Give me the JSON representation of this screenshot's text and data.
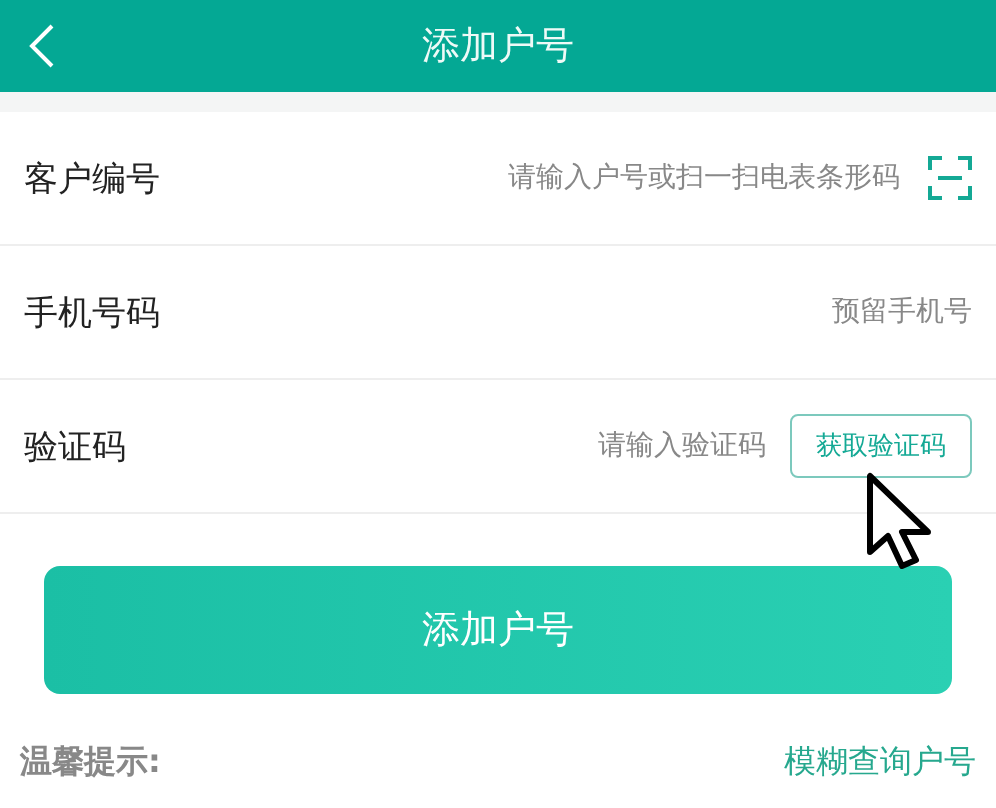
{
  "header": {
    "title": "添加户号"
  },
  "fields": [
    {
      "label": "客户编号",
      "placeholder": "请输入户号或扫一扫电表条形码",
      "kind": "scan"
    },
    {
      "label": "手机号码",
      "placeholder": "预留手机号",
      "kind": "plain"
    },
    {
      "label": "验证码",
      "placeholder": "请输入验证码",
      "kind": "code",
      "action": "获取验证码"
    }
  ],
  "submit": "添加户号",
  "tip": {
    "title": "温馨提示:",
    "link": "模糊查询户号"
  }
}
